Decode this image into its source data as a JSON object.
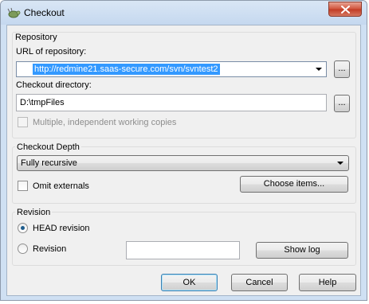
{
  "window": {
    "title": "Checkout",
    "close_label": "✕"
  },
  "repository": {
    "group_title": "Repository",
    "url_label": "URL of repository:",
    "url_value": "http://redmine21.saas-secure.com/svn/svntest2",
    "url_browse_label": "...",
    "dir_label": "Checkout directory:",
    "dir_value": "D:\\tmpFiles",
    "dir_browse_label": "...",
    "multiple_label": "Multiple, independent working copies",
    "multiple_checked": false,
    "multiple_enabled": false
  },
  "depth": {
    "group_title": "Checkout Depth",
    "selected": "Fully recursive",
    "omit_label": "Omit externals",
    "omit_checked": false,
    "choose_items_label": "Choose items..."
  },
  "revision": {
    "group_title": "Revision",
    "head_label": "HEAD revision",
    "head_selected": true,
    "revision_label": "Revision",
    "revision_value": "",
    "show_log_label": "Show log"
  },
  "buttons": {
    "ok_label": "OK",
    "cancel_label": "Cancel",
    "help_label": "Help"
  },
  "colors": {
    "selection": "#3399ff",
    "dialog_bg": "#f0f0f0",
    "frame": "#cfe0f3",
    "close_red": "#c13a23"
  }
}
